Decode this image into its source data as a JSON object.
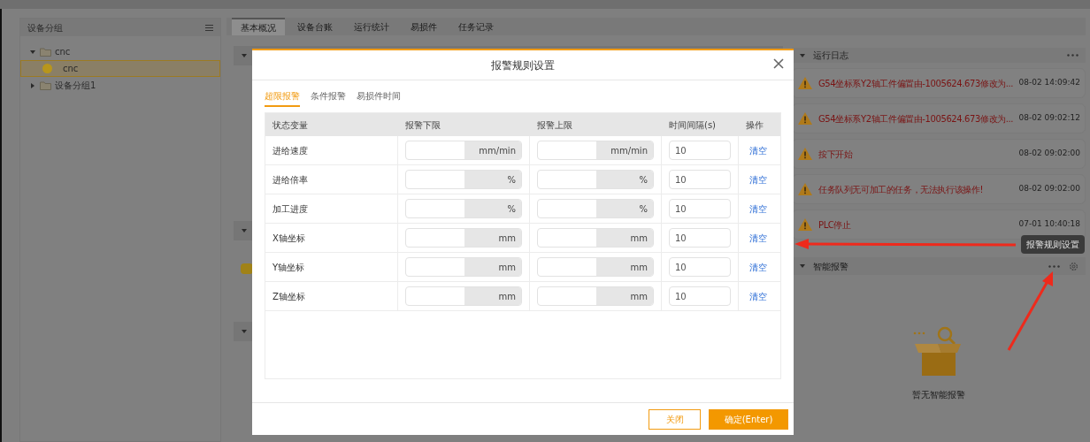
{
  "sidebar": {
    "title": "设备分组",
    "tree": [
      {
        "label": "cnc",
        "kind": "folder",
        "expanded": true,
        "selected": false,
        "children": [
          {
            "label": "cnc",
            "kind": "device",
            "selected": true,
            "color": "#b8961c"
          }
        ]
      },
      {
        "label": "设备分组1",
        "kind": "folder",
        "expanded": false,
        "selected": false
      }
    ]
  },
  "tabs": [
    {
      "label": "基本概况",
      "selected": true
    },
    {
      "label": "设备台账",
      "selected": false
    },
    {
      "label": "运行统计",
      "selected": false
    },
    {
      "label": "易损件",
      "selected": false
    },
    {
      "label": "任务记录",
      "selected": false
    }
  ],
  "log_panel": {
    "title": "运行日志",
    "entries": [
      {
        "message": "G54坐标系Y2轴工件偏置由-1005624.673修改为...",
        "time": "08-02 14:09:42"
      },
      {
        "message": "G54坐标系Y2轴工件偏置由-1005624.673修改为...",
        "time": "08-02 09:02:12"
      },
      {
        "message": "按下开始",
        "time": "08-02 09:02:00"
      },
      {
        "message": "任务队列无可加工的任务，无法执行该操作!",
        "time": "08-02 09:02:00"
      },
      {
        "message": "PLC停止",
        "time": "07-01 10:40:18"
      }
    ]
  },
  "alarm_panel": {
    "title": "智能报警",
    "empty_text": "暂无智能报警"
  },
  "tooltip": "报警规则设置",
  "dialog": {
    "title": "报警规则设置",
    "tabs": [
      {
        "label": "超限报警",
        "selected": true
      },
      {
        "label": "条件报警",
        "selected": false
      },
      {
        "label": "易损件时间",
        "selected": false
      }
    ],
    "columns": [
      "状态变量",
      "报警下限",
      "报警上限",
      "时间间隔(s)",
      "操作"
    ],
    "rows": [
      {
        "variable": "进给速度",
        "units": [
          "mm/min",
          "mm/min"
        ],
        "interval": "10",
        "action": "清空"
      },
      {
        "variable": "进给倍率",
        "units": [
          "%",
          "%"
        ],
        "interval": "10",
        "action": "清空"
      },
      {
        "variable": "加工进度",
        "units": [
          "%",
          "%"
        ],
        "interval": "10",
        "action": "清空"
      },
      {
        "variable": "X轴坐标",
        "units": [
          "mm",
          "mm"
        ],
        "interval": "10",
        "action": "清空"
      },
      {
        "variable": "Y轴坐标",
        "units": [
          "mm",
          "mm"
        ],
        "interval": "10",
        "action": "清空"
      },
      {
        "variable": "Z轴坐标",
        "units": [
          "mm",
          "mm"
        ],
        "interval": "10",
        "action": "清空"
      }
    ],
    "buttons": [
      {
        "label": "关闭",
        "kind": "secondary"
      },
      {
        "label": "确定(Enter)",
        "kind": "primary"
      }
    ]
  }
}
